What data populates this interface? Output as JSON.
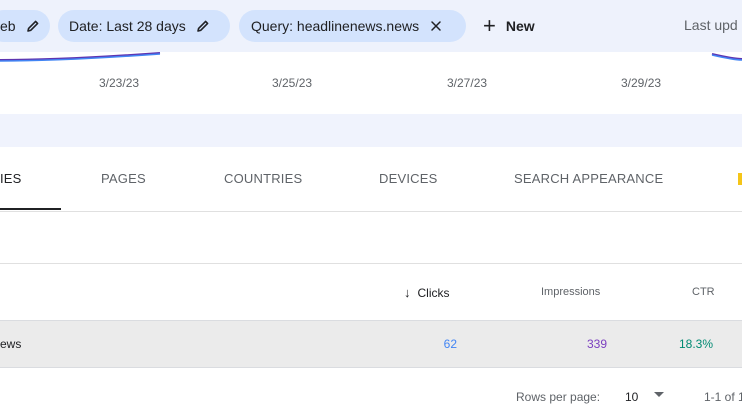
{
  "filters": {
    "chips": [
      {
        "label": "eb",
        "icon": "pencil-icon"
      },
      {
        "label": "Date: Last 28 days",
        "icon": "pencil-icon"
      },
      {
        "label": "Query: headlinenews.news",
        "icon": "close-icon"
      }
    ],
    "new_label": "New",
    "last_updated": "Last upd"
  },
  "chart": {
    "x_ticks": [
      "3/23/23",
      "3/25/23",
      "3/27/23",
      "3/29/23"
    ],
    "line_colors": {
      "clicks": "#4285f4",
      "impressions": "#5e35b1"
    }
  },
  "tabs": [
    {
      "label": "IES",
      "active": true
    },
    {
      "label": "PAGES",
      "active": false
    },
    {
      "label": "COUNTRIES",
      "active": false
    },
    {
      "label": "DEVICES",
      "active": false
    },
    {
      "label": "SEARCH APPEARANCE",
      "active": false
    }
  ],
  "table": {
    "columns": {
      "clicks": "Clicks",
      "impressions": "Impressions",
      "ctr": "CTR"
    },
    "sorted_by": "clicks",
    "rows": [
      {
        "query": "ews",
        "clicks": "62",
        "impressions": "339",
        "ctr": "18.3%"
      }
    ]
  },
  "pagination": {
    "rows_per_page_label": "Rows per page:",
    "rows_per_page": "10",
    "range": "1-1 of 1"
  },
  "colors": {
    "chip_bg": "#d3e3fd",
    "clicks": "#4285f4",
    "impressions": "#7b3fbf",
    "ctr": "#008a73"
  }
}
